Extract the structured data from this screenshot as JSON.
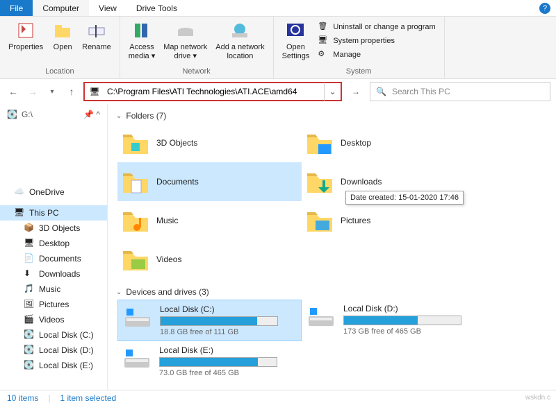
{
  "tabs": {
    "file": "File",
    "computer": "Computer",
    "view": "View",
    "drivetools": "Drive Tools"
  },
  "ribbon": {
    "location": {
      "label": "Location",
      "properties": "Properties",
      "open": "Open",
      "rename": "Rename"
    },
    "network": {
      "label": "Network",
      "access": "Access\nmedia ▾",
      "mapdrive": "Map network\ndrive ▾",
      "addloc": "Add a network\nlocation"
    },
    "open_settings": "Open\nSettings",
    "system": {
      "label": "System",
      "uninstall": "Uninstall or change a program",
      "sysprops": "System properties",
      "manage": "Manage"
    }
  },
  "nav": {
    "address": "C:\\Program Files\\ATI Technologies\\ATI.ACE\\amd64",
    "search_placeholder": "Search This PC"
  },
  "sidebar": {
    "quick": "G:\\",
    "onedrive": "OneDrive",
    "thispc": "This PC",
    "items": [
      "3D Objects",
      "Desktop",
      "Documents",
      "Downloads",
      "Music",
      "Pictures",
      "Videos",
      "Local Disk (C:)",
      "Local Disk (D:)",
      "Local Disk (E:)"
    ]
  },
  "content": {
    "folders_header": "Folders (7)",
    "folders": [
      {
        "name": "3D Objects"
      },
      {
        "name": "Desktop"
      },
      {
        "name": "Documents",
        "selected": true
      },
      {
        "name": "Downloads"
      },
      {
        "name": "Music"
      },
      {
        "name": "Pictures"
      },
      {
        "name": "Videos"
      }
    ],
    "tooltip": "Date created: 15-01-2020 17:46",
    "drives_header": "Devices and drives (3)",
    "drives": [
      {
        "name": "Local Disk (C:)",
        "free": "18.8 GB free of 111 GB",
        "pct": 83,
        "selected": true
      },
      {
        "name": "Local Disk (D:)",
        "free": "173 GB free of 465 GB",
        "pct": 63
      },
      {
        "name": "Local Disk (E:)",
        "free": "73.0 GB free of 465 GB",
        "pct": 84
      }
    ]
  },
  "status": {
    "items": "10 items",
    "selected": "1 item selected"
  },
  "watermark": "wskdn.c"
}
